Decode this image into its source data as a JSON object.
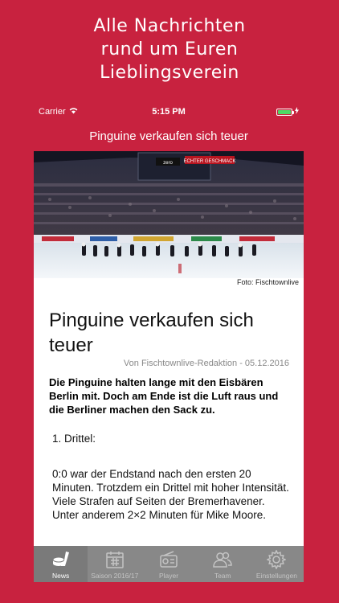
{
  "promo": {
    "line1": "Alle Nachrichten",
    "line2": "rund um Euren",
    "line3": "Lieblingsverein"
  },
  "status": {
    "carrier": "Carrier",
    "time": "5:15 PM",
    "battery_level": 1.0
  },
  "nav": {
    "title": "Pinguine verkaufen sich teuer"
  },
  "hero": {
    "caption": "Foto: Fischtownlive",
    "banner_text": "ECHTER GESCHMACK",
    "brand_text": "zero"
  },
  "article": {
    "title": "Pinguine verkaufen sich teuer",
    "byline": "Von Fischtownlive-Redaktion - 05.12.2016",
    "lead": "Die Pinguine halten lange mit den Eisbären Berlin mit. Doch am Ende ist die Luft raus und die Berliner machen den Sack zu.",
    "section": "1. Drittel:",
    "body": "0:0 war der Endstand nach den ersten 20 Minuten. Trotzdem ein Drittel mit hoher Intensität. Viele Strafen auf Seiten der Bremerhavener. Unter anderem 2×2 Minuten für Mike Moore."
  },
  "tabs": [
    {
      "label": "News",
      "icon": "hockey-icon",
      "active": true
    },
    {
      "label": "Saison 2016/17",
      "icon": "calendar-icon",
      "active": false
    },
    {
      "label": "Player",
      "icon": "radio-icon",
      "active": false
    },
    {
      "label": "Team",
      "icon": "team-icon",
      "active": false
    },
    {
      "label": "Einstellungen",
      "icon": "gear-icon",
      "active": false
    }
  ],
  "colors": {
    "brand_red": "#c8223f",
    "tabbar_gray": "#888888",
    "battery_green": "#4cd964"
  }
}
